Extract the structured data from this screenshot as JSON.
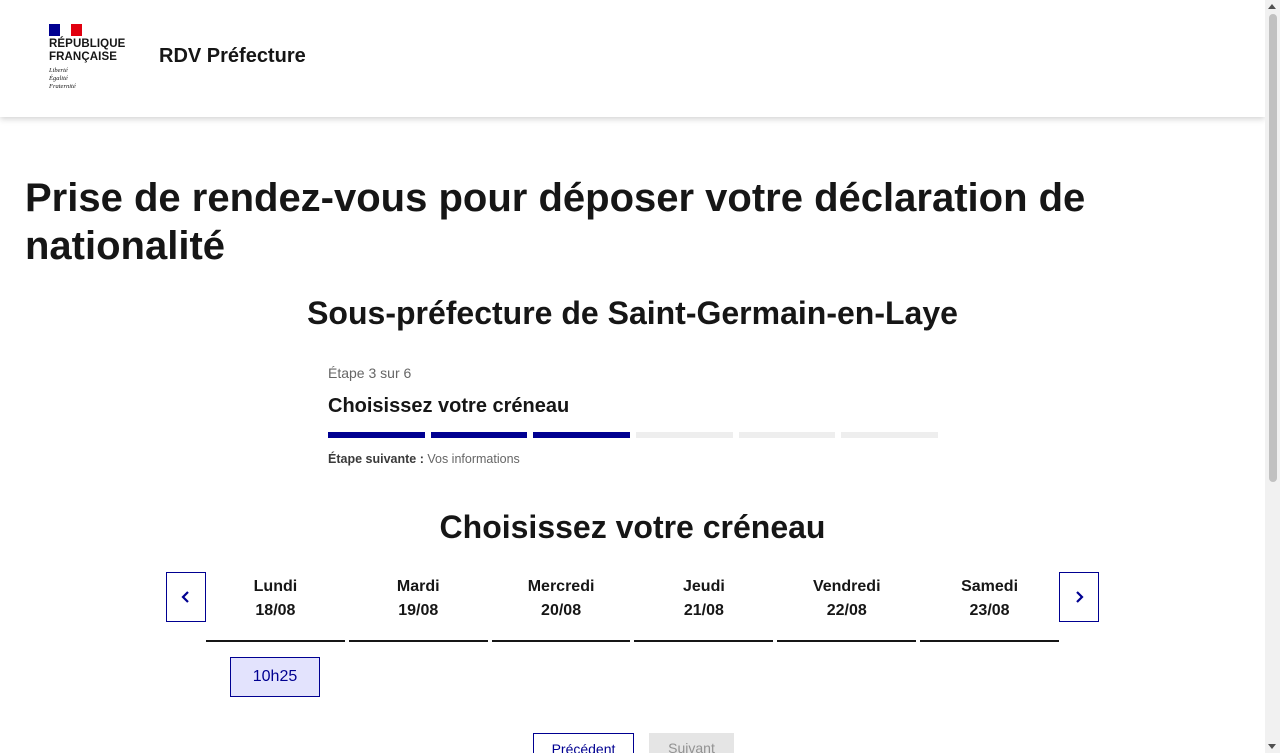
{
  "header": {
    "marianne_line1": "RÉPUBLIQUE",
    "marianne_line2": "FRANÇAISE",
    "devise_1": "Liberté",
    "devise_2": "Égalité",
    "devise_3": "Fraternité",
    "service_title": "RDV Préfecture"
  },
  "page": {
    "title": "Prise de rendez-vous pour déposer votre déclaration de nationalité",
    "subtitle": "Sous-préfecture de Saint-Germain-en-Laye"
  },
  "stepper": {
    "state": "Étape 3 sur 6",
    "title": "Choisissez votre créneau",
    "current_step": 3,
    "total_steps": 6,
    "next_label": "Étape suivante :",
    "next_value": "Vos informations"
  },
  "calendar": {
    "title": "Choisissez votre créneau",
    "days": [
      {
        "name": "Lundi",
        "date": "18/08"
      },
      {
        "name": "Mardi",
        "date": "19/08"
      },
      {
        "name": "Mercredi",
        "date": "20/08"
      },
      {
        "name": "Jeudi",
        "date": "21/08"
      },
      {
        "name": "Vendredi",
        "date": "22/08"
      },
      {
        "name": "Samedi",
        "date": "23/08"
      }
    ],
    "slots": [
      {
        "day": "Lundi",
        "time": "10h25"
      }
    ]
  },
  "buttons": {
    "previous": "Précédent",
    "next": "Suivant"
  },
  "colors": {
    "primary": "#000091",
    "flag_red": "#e1000f",
    "slot_bg": "#e3e3fd"
  }
}
